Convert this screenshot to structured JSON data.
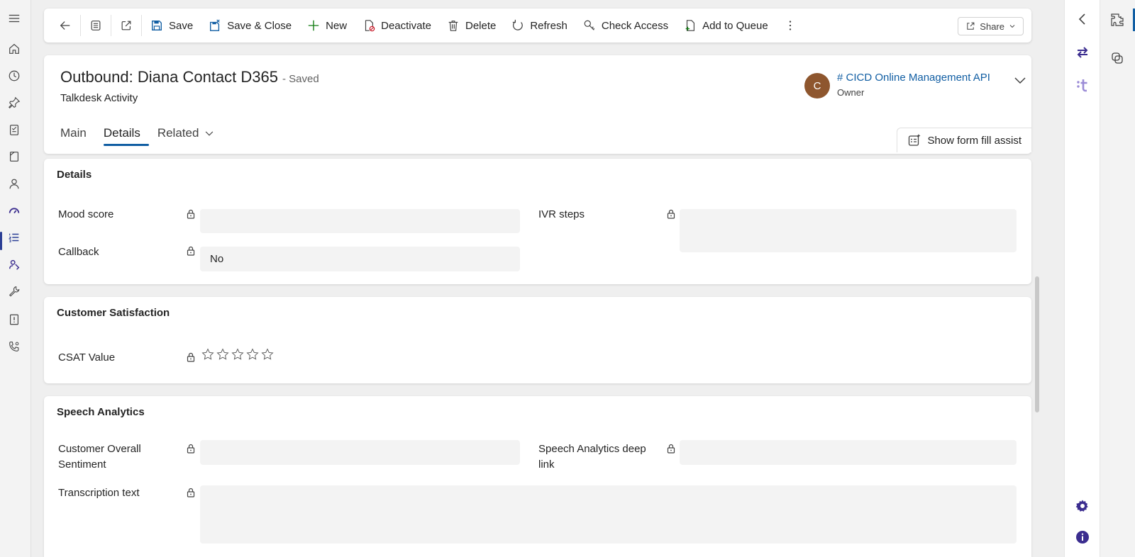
{
  "left_nav": {
    "icons": [
      "hamburger-icon",
      "home-icon",
      "recent-icon",
      "pin-icon",
      "clipboard-icon",
      "book-icon",
      "person-icon",
      "dashboard-icon",
      "list-icon",
      "people-icon",
      "wrench-icon",
      "notebook-icon",
      "phone-settings-icon"
    ],
    "active_item": "list-icon"
  },
  "command_bar": {
    "save": "Save",
    "save_close": "Save & Close",
    "new": "New",
    "deactivate": "Deactivate",
    "delete": "Delete",
    "refresh": "Refresh",
    "check_access": "Check Access",
    "add_to_queue": "Add to Queue",
    "share": "Share"
  },
  "record": {
    "title": "Outbound: Diana Contact D365",
    "status": "- Saved",
    "entity": "Talkdesk Activity",
    "owner_initial": "C",
    "owner_name": "# CICD Online Management API",
    "owner_role": "Owner",
    "owner_avatar_color": "#8e562e"
  },
  "tabs": [
    {
      "label": "Main"
    },
    {
      "label": "Details",
      "active": true
    },
    {
      "label": "Related"
    }
  ],
  "form_assist": "Show form fill assist",
  "sections": {
    "details": {
      "title": "Details",
      "mood_score_label": "Mood score",
      "mood_score_value": "",
      "callback_label": "Callback",
      "callback_value": "No",
      "ivr_steps_label": "IVR steps",
      "ivr_steps_value": ""
    },
    "csat": {
      "title": "Customer Satisfaction",
      "csat_label": "CSAT Value",
      "csat_rating": 0,
      "csat_max": 5
    },
    "speech": {
      "title": "Speech Analytics",
      "sentiment_label_1": "Customer Overall",
      "sentiment_label_2": "Sentiment",
      "sentiment_value": "",
      "deep_link_label_1": "Speech Analytics deep",
      "deep_link_label_2": "link",
      "deep_link_value": "",
      "transcription_label": "Transcription text",
      "transcription_value": ""
    }
  },
  "colors": {
    "accent": "#115ea3",
    "nav_active": "#2b3e95",
    "right_pane_purple": "#3b2d8f"
  }
}
